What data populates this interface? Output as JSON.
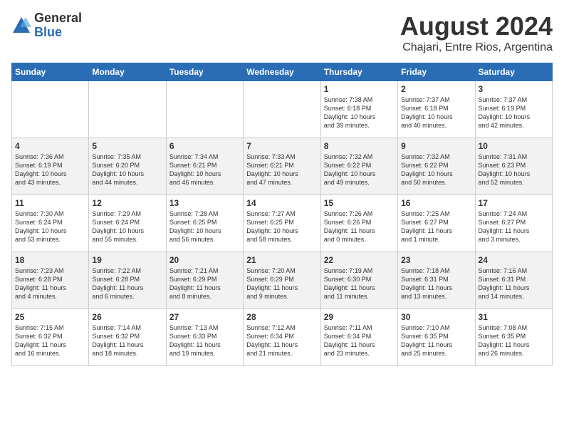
{
  "header": {
    "logo_general": "General",
    "logo_blue": "Blue",
    "month_title": "August 2024",
    "subtitle": "Chajari, Entre Rios, Argentina"
  },
  "days_of_week": [
    "Sunday",
    "Monday",
    "Tuesday",
    "Wednesday",
    "Thursday",
    "Friday",
    "Saturday"
  ],
  "weeks": [
    [
      {
        "day": "",
        "content": ""
      },
      {
        "day": "",
        "content": ""
      },
      {
        "day": "",
        "content": ""
      },
      {
        "day": "",
        "content": ""
      },
      {
        "day": "1",
        "content": "Sunrise: 7:38 AM\nSunset: 6:18 PM\nDaylight: 10 hours\nand 39 minutes."
      },
      {
        "day": "2",
        "content": "Sunrise: 7:37 AM\nSunset: 6:18 PM\nDaylight: 10 hours\nand 40 minutes."
      },
      {
        "day": "3",
        "content": "Sunrise: 7:37 AM\nSunset: 6:19 PM\nDaylight: 10 hours\nand 42 minutes."
      }
    ],
    [
      {
        "day": "4",
        "content": "Sunrise: 7:36 AM\nSunset: 6:19 PM\nDaylight: 10 hours\nand 43 minutes."
      },
      {
        "day": "5",
        "content": "Sunrise: 7:35 AM\nSunset: 6:20 PM\nDaylight: 10 hours\nand 44 minutes."
      },
      {
        "day": "6",
        "content": "Sunrise: 7:34 AM\nSunset: 6:21 PM\nDaylight: 10 hours\nand 46 minutes."
      },
      {
        "day": "7",
        "content": "Sunrise: 7:33 AM\nSunset: 6:21 PM\nDaylight: 10 hours\nand 47 minutes."
      },
      {
        "day": "8",
        "content": "Sunrise: 7:32 AM\nSunset: 6:22 PM\nDaylight: 10 hours\nand 49 minutes."
      },
      {
        "day": "9",
        "content": "Sunrise: 7:32 AM\nSunset: 6:22 PM\nDaylight: 10 hours\nand 50 minutes."
      },
      {
        "day": "10",
        "content": "Sunrise: 7:31 AM\nSunset: 6:23 PM\nDaylight: 10 hours\nand 52 minutes."
      }
    ],
    [
      {
        "day": "11",
        "content": "Sunrise: 7:30 AM\nSunset: 6:24 PM\nDaylight: 10 hours\nand 53 minutes."
      },
      {
        "day": "12",
        "content": "Sunrise: 7:29 AM\nSunset: 6:24 PM\nDaylight: 10 hours\nand 55 minutes."
      },
      {
        "day": "13",
        "content": "Sunrise: 7:28 AM\nSunset: 6:25 PM\nDaylight: 10 hours\nand 56 minutes."
      },
      {
        "day": "14",
        "content": "Sunrise: 7:27 AM\nSunset: 6:25 PM\nDaylight: 10 hours\nand 58 minutes."
      },
      {
        "day": "15",
        "content": "Sunrise: 7:26 AM\nSunset: 6:26 PM\nDaylight: 11 hours\nand 0 minutes."
      },
      {
        "day": "16",
        "content": "Sunrise: 7:25 AM\nSunset: 6:27 PM\nDaylight: 11 hours\nand 1 minute."
      },
      {
        "day": "17",
        "content": "Sunrise: 7:24 AM\nSunset: 6:27 PM\nDaylight: 11 hours\nand 3 minutes."
      }
    ],
    [
      {
        "day": "18",
        "content": "Sunrise: 7:23 AM\nSunset: 6:28 PM\nDaylight: 11 hours\nand 4 minutes."
      },
      {
        "day": "19",
        "content": "Sunrise: 7:22 AM\nSunset: 6:28 PM\nDaylight: 11 hours\nand 6 minutes."
      },
      {
        "day": "20",
        "content": "Sunrise: 7:21 AM\nSunset: 6:29 PM\nDaylight: 11 hours\nand 8 minutes."
      },
      {
        "day": "21",
        "content": "Sunrise: 7:20 AM\nSunset: 6:29 PM\nDaylight: 11 hours\nand 9 minutes."
      },
      {
        "day": "22",
        "content": "Sunrise: 7:19 AM\nSunset: 6:30 PM\nDaylight: 11 hours\nand 11 minutes."
      },
      {
        "day": "23",
        "content": "Sunrise: 7:18 AM\nSunset: 6:31 PM\nDaylight: 11 hours\nand 13 minutes."
      },
      {
        "day": "24",
        "content": "Sunrise: 7:16 AM\nSunset: 6:31 PM\nDaylight: 11 hours\nand 14 minutes."
      }
    ],
    [
      {
        "day": "25",
        "content": "Sunrise: 7:15 AM\nSunset: 6:32 PM\nDaylight: 11 hours\nand 16 minutes."
      },
      {
        "day": "26",
        "content": "Sunrise: 7:14 AM\nSunset: 6:32 PM\nDaylight: 11 hours\nand 18 minutes."
      },
      {
        "day": "27",
        "content": "Sunrise: 7:13 AM\nSunset: 6:33 PM\nDaylight: 11 hours\nand 19 minutes."
      },
      {
        "day": "28",
        "content": "Sunrise: 7:12 AM\nSunset: 6:34 PM\nDaylight: 11 hours\nand 21 minutes."
      },
      {
        "day": "29",
        "content": "Sunrise: 7:11 AM\nSunset: 6:34 PM\nDaylight: 11 hours\nand 23 minutes."
      },
      {
        "day": "30",
        "content": "Sunrise: 7:10 AM\nSunset: 6:35 PM\nDaylight: 11 hours\nand 25 minutes."
      },
      {
        "day": "31",
        "content": "Sunrise: 7:08 AM\nSunset: 6:35 PM\nDaylight: 11 hours\nand 26 minutes."
      }
    ]
  ]
}
